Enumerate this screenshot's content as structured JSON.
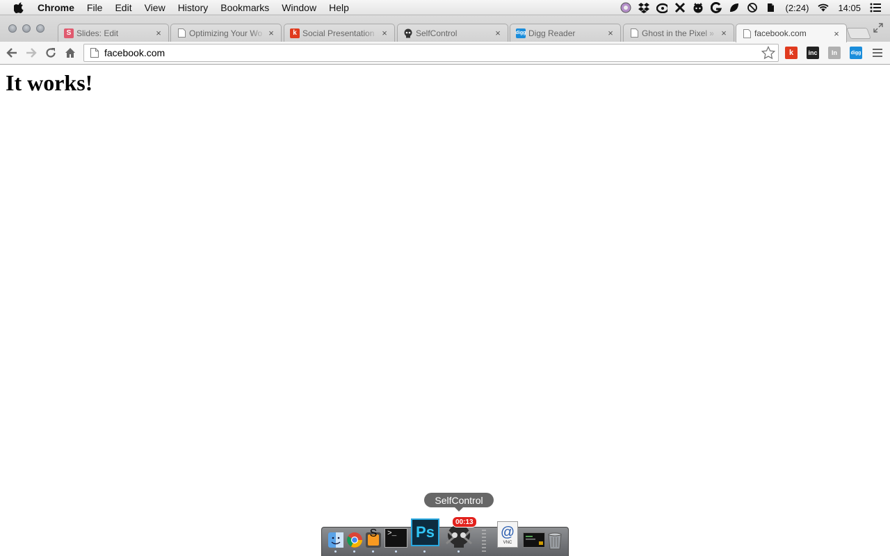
{
  "menubar": {
    "app_name": "Chrome",
    "items": [
      "File",
      "Edit",
      "View",
      "History",
      "Bookmarks",
      "Window",
      "Help"
    ],
    "battery_text": "(2:24)",
    "clock": "14:05"
  },
  "tabs": [
    {
      "title": "Slides: Edit",
      "favicon": "S",
      "favicon_color": "#e05a6f"
    },
    {
      "title": "Optimizing Your Wo",
      "favicon": "",
      "favicon_color": ""
    },
    {
      "title": "Social Presentation",
      "favicon": "k",
      "favicon_color": "#e03a1e"
    },
    {
      "title": "SelfControl",
      "favicon": "",
      "favicon_color": ""
    },
    {
      "title": "Digg Reader",
      "favicon": "digg",
      "favicon_color": "#1a8ddb"
    },
    {
      "title": "Ghost in the Pixel »",
      "favicon": "",
      "favicon_color": ""
    },
    {
      "title": "facebook.com",
      "favicon": "",
      "favicon_color": "",
      "active": true
    }
  ],
  "tab_close_glyph": "×",
  "omnibox": {
    "url": "facebook.com"
  },
  "extensions": [
    {
      "label": "k",
      "color": "#e03a1e"
    },
    {
      "label": "inc",
      "color": "#222222"
    },
    {
      "label": "In",
      "color": "#b0b0b0"
    },
    {
      "label": "digg",
      "color": "#1a8ddb"
    }
  ],
  "page": {
    "heading": "It works!"
  },
  "dock": {
    "tooltip": "SelfControl",
    "badge": "00:13",
    "vnc_label": "VNC",
    "ps_label": "Ps",
    "sublime_label": "S",
    "terminal_label": ">_"
  }
}
